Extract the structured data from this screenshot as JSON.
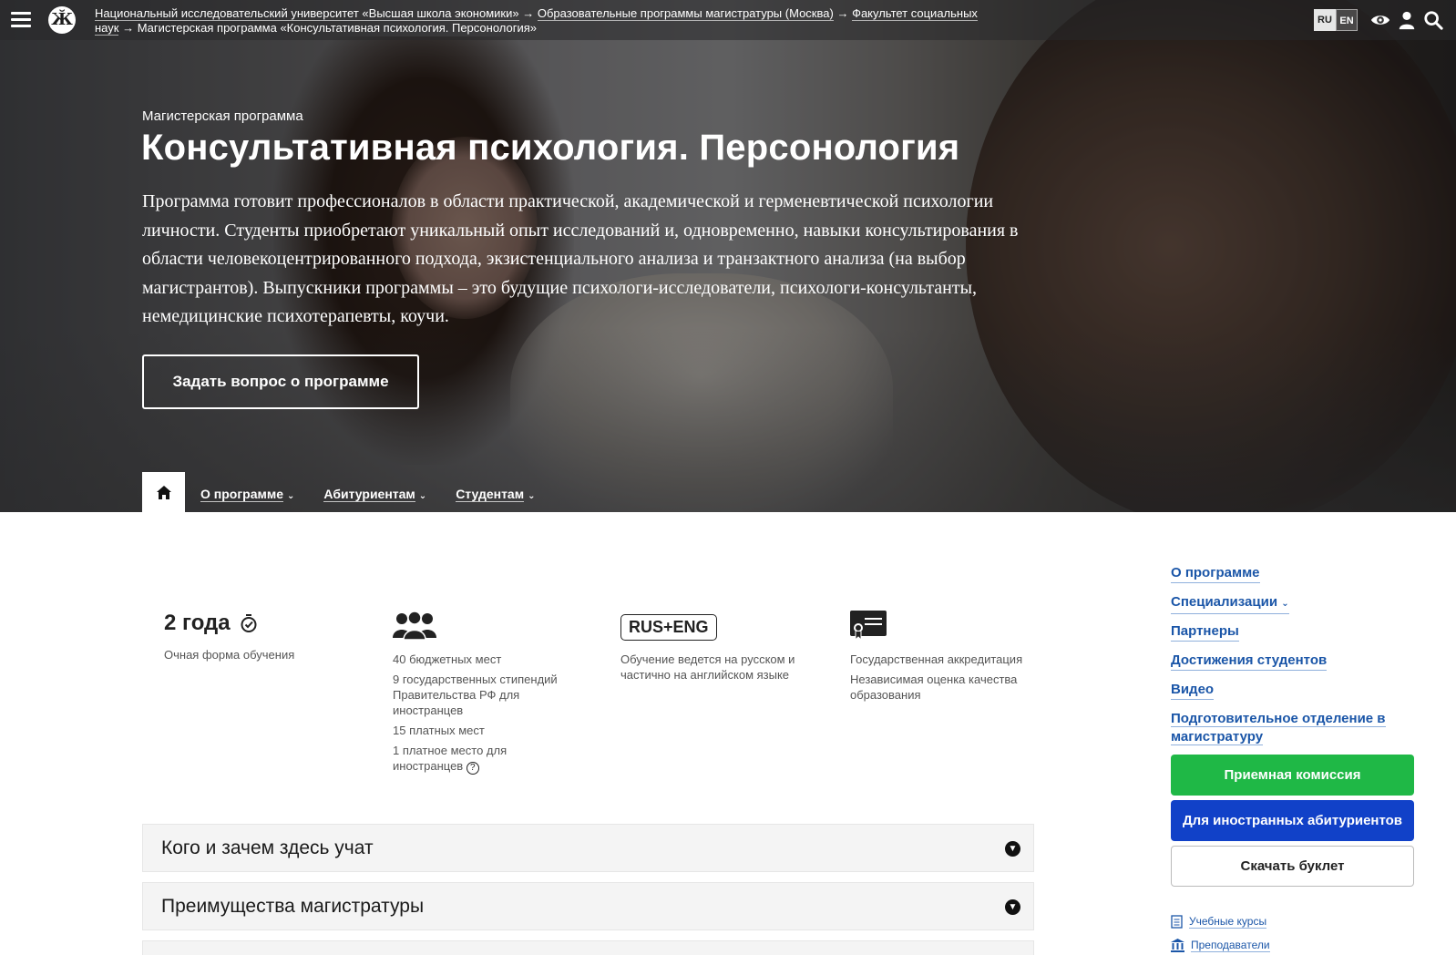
{
  "topbar": {
    "logo": "Ӂ",
    "breadcrumbs": [
      "Национальный исследовательский университет «Высшая школа экономики»",
      "Образовательные программы магистратуры (Москва)",
      "Факультет социальных наук",
      "Магистерская программа «Консультативная психология. Персонология»"
    ],
    "arrow": "→",
    "lang_ru": "RU",
    "lang_en": "EN"
  },
  "hero": {
    "kicker": "Магистерская программа",
    "title": "Консультативная психология. Персонология",
    "lead": "Программа готовит профессионалов в области практической, академической и герменевтической психологии личности. Студенты приобретают уникальный опыт исследований и, одновременно, навыки консультирования в области человекоцентрированного подхода, экзистенциального анализа и транзактного анализа (на выбор магистрантов). Выпускники программы – это будущие психологи-исследователи, психологи-консультанты, немедицинские психотерапевты, коучи.",
    "ask_button": "Задать вопрос о программе"
  },
  "tabs": [
    {
      "label": "О программе"
    },
    {
      "label": "Абитуриентам"
    },
    {
      "label": "Студентам"
    }
  ],
  "stats": {
    "duration": "2 года",
    "duration_note": "Очная форма обучения",
    "places": [
      "40 бюджетных мест",
      "9 государственных стипендий Правительства РФ для иностранцев",
      "15 платных мест",
      "1 платное место для иностранцев"
    ],
    "language_badge": "RUS+ENG",
    "language_note": "Обучение ведется на русском и частично на английском языке",
    "accreditation": [
      "Государственная аккредитация",
      "Независимая оценка качества образования"
    ]
  },
  "accordion": [
    {
      "title": "Кого и зачем здесь учат"
    },
    {
      "title": "Преимущества магистратуры"
    }
  ],
  "sidebar": {
    "links": [
      "О программе",
      "Специализации",
      "Партнеры",
      "Достижения студентов",
      "Видео",
      "Подготовительное отделение в магистратуру"
    ],
    "btn_admission": "Приемная комиссия",
    "btn_foreign": "Для иностранных абитуриентов",
    "btn_booklet": "Скачать буклет",
    "mini_courses": "Учебные курсы",
    "mini_teachers": "Преподаватели"
  },
  "colors": {
    "green": "#1fb846",
    "blue": "#1141c8",
    "link": "#1b56a8"
  }
}
